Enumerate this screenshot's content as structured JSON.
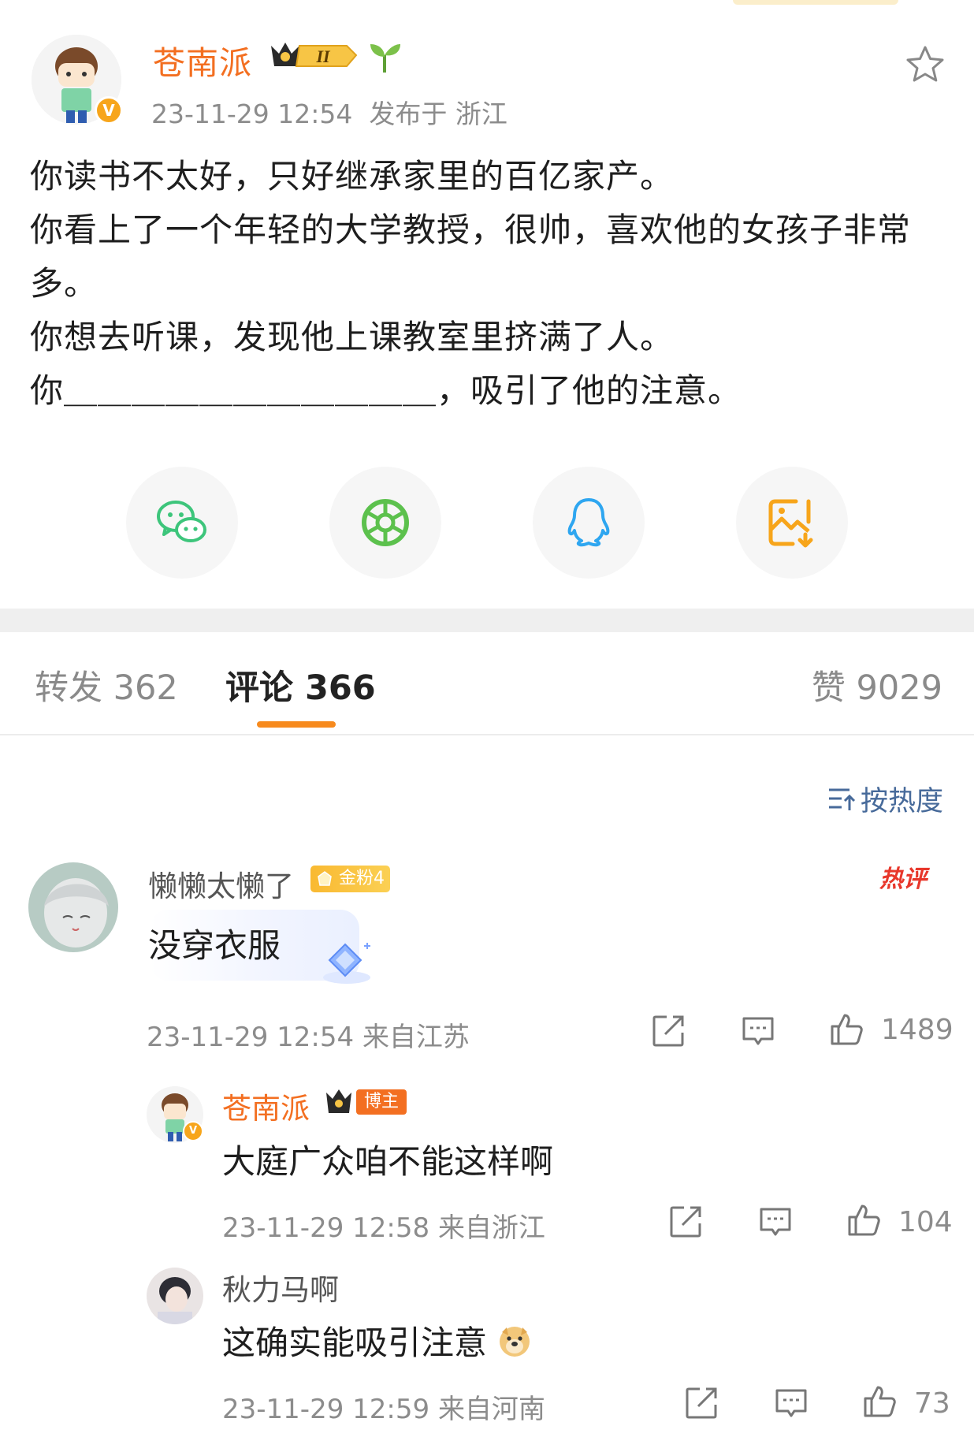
{
  "post": {
    "author": "苍南派",
    "level_badge": "II",
    "time": "23-11-29 12:54",
    "location": "发布于 浙江",
    "lines": [
      "你读书不太好，只好继承家里的百亿家产。",
      "你看上了一个年轻的大学教授，很帅，喜欢他的女孩子非常",
      "多。",
      "你想去听课，发现他上课教室里挤满了人。",
      "你＿＿＿＿＿＿＿＿＿＿＿，吸引了他的注意。"
    ]
  },
  "share_icons": [
    "wechat-icon",
    "moments-icon",
    "qq-icon",
    "save-image-icon"
  ],
  "tabs": {
    "repost": "转发 362",
    "comments": "评论 366",
    "likes": "赞 9029"
  },
  "sort_label": "按热度",
  "comments": [
    {
      "name": "懒懒太懒了",
      "badge": "金粉4",
      "hot_tag": "热评",
      "text": "没穿衣服",
      "time": "23-11-29 12:54",
      "location": "来自江苏",
      "likes": "1489"
    }
  ],
  "replies": [
    {
      "name": "苍南派",
      "badge": "博主",
      "text": "大庭广众咱不能这样啊",
      "time": "23-11-29 12:58",
      "location": "来自浙江",
      "likes": "104"
    },
    {
      "name": "秋力马啊",
      "text": "这确实能吸引注意",
      "time": "23-11-29 12:59",
      "location": "来自河南",
      "likes": "73"
    }
  ],
  "colors": {
    "author_orange": "#f36f21",
    "tab_underline": "#f78a1d",
    "sort_blue": "#476a9a",
    "hot_red": "#e8372b",
    "wechat_green": "#3dc57b",
    "qq_blue": "#2ea6f0",
    "save_orange": "#f7a51b"
  }
}
